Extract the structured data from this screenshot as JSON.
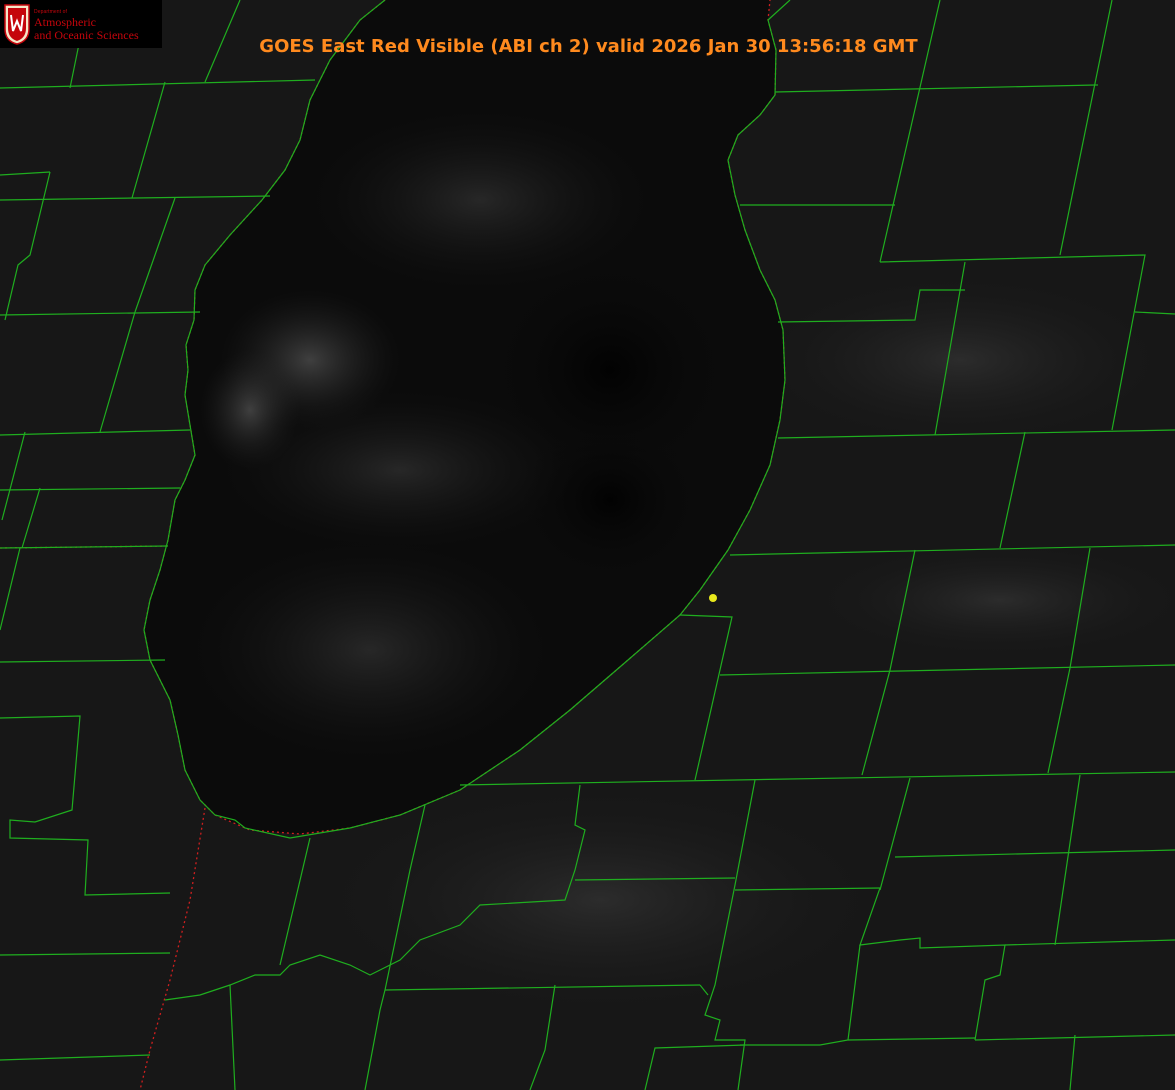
{
  "title": "GOES East Red Visible (ABI ch 2) valid 2026 Jan 30 13:56:18 GMT",
  "logo": {
    "small": "Department of",
    "line1": "Atmospheric",
    "line2": "and Oceanic Sciences",
    "brand_color": "#c5050c"
  },
  "colors": {
    "title": "#ff8a1e",
    "county_lines": "#1fae1f",
    "state_line": "#d01f1f",
    "marker": "#e8e81c",
    "lake": "#050505",
    "land": "#151515"
  },
  "map": {
    "marker_label": "location-marker"
  }
}
